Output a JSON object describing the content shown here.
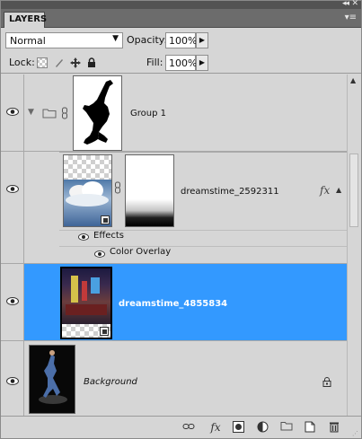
{
  "panel": {
    "tab_label": "LAYERS",
    "collapse_glyph": "◂◂",
    "close_glyph": "✕",
    "menu_glyph": "▾≡"
  },
  "controls": {
    "blend_mode": "Normal",
    "opacity_label": "Opacity:",
    "opacity_value": "100%",
    "lock_label": "Lock:",
    "fill_label": "Fill:",
    "fill_value": "100%"
  },
  "layers": [
    {
      "name": "Group 1",
      "type": "group",
      "visible": true,
      "selected": false
    },
    {
      "name": "dreamstime_2592311",
      "type": "layer-with-mask",
      "visible": true,
      "selected": false,
      "has_fx": true,
      "effects_label": "Effects",
      "effects": [
        "Color Overlay"
      ]
    },
    {
      "name": "dreamstime_4855834",
      "type": "smart-object",
      "visible": true,
      "selected": true
    },
    {
      "name": "Background",
      "type": "background",
      "visible": true,
      "selected": false,
      "locked": true
    }
  ],
  "fx_glyph": "fx",
  "colors": {
    "selection": "#3399ff",
    "panel_bg": "#d6d6d6",
    "tab_bar": "#6c6c6c"
  },
  "bottom_icons": [
    "link-layers-icon",
    "add-style-icon",
    "add-mask-icon",
    "adjustment-layer-icon",
    "new-group-icon",
    "new-layer-icon",
    "delete-layer-icon"
  ]
}
